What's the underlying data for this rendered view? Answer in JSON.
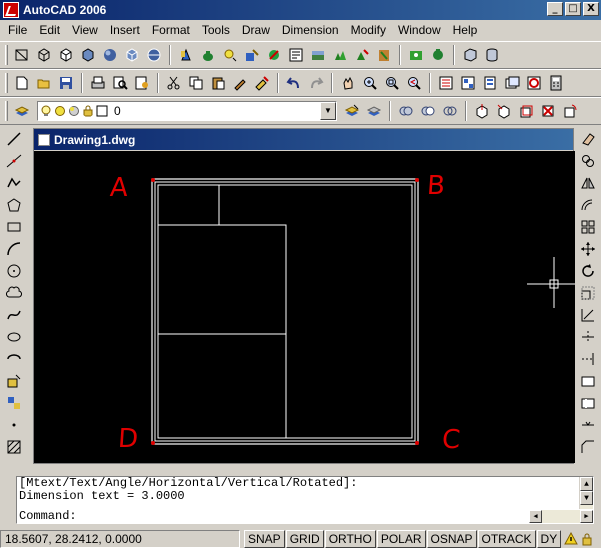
{
  "window": {
    "title": "AutoCAD 2006"
  },
  "title_buttons": {
    "minimize": "_",
    "restore": "□",
    "close": "X"
  },
  "menu": [
    "File",
    "Edit",
    "View",
    "Insert",
    "Format",
    "Tools",
    "Draw",
    "Dimension",
    "Modify",
    "Window",
    "Help"
  ],
  "layer": {
    "current": "0"
  },
  "document": {
    "title": "Drawing1.dwg"
  },
  "markers": {
    "a": "A",
    "b": "B",
    "c": "C",
    "d": "D"
  },
  "command": {
    "line1": "[Mtext/Text/Angle/Horizontal/Vertical/Rotated]:",
    "line2": "Dimension text = 3.0000",
    "prompt": "Command:"
  },
  "status": {
    "coords": "18.5607, 28.2412, 0.0000",
    "buttons": [
      "SNAP",
      "GRID",
      "ORTHO",
      "POLAR",
      "OSNAP",
      "OTRACK",
      "DY"
    ]
  },
  "colors": {
    "titlebar": "#0a246a",
    "canvas_bg": "#000000",
    "geometry": "#ffffff",
    "marker": "#e00000"
  }
}
